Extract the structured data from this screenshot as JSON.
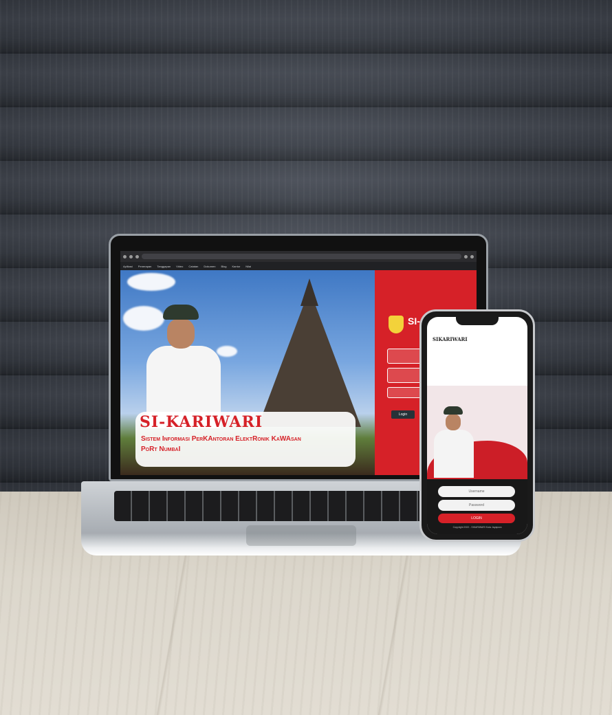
{
  "browser": {
    "bookmarks": [
      "Aplikasi",
      "Penerapan",
      "Tanggapan",
      "Video",
      "Catatan",
      "Dokumen",
      "Blog",
      "Kantor",
      "Nilai"
    ]
  },
  "laptop_site": {
    "app_title": "SI-KARIWARI",
    "subtitle_line1": "Sistem Informasi PerKAntoran ElektRonik KaWAsan",
    "subtitle_line2": "PoRt NumbaI",
    "panel_title": "SI-",
    "login_label": "Login"
  },
  "phone_site": {
    "app_name": "SIKARIWARI",
    "username_placeholder": "Username",
    "password_placeholder": "Password",
    "login_label": "LOGIN",
    "copyright": "Copyright 2022 - SIKARIWARI Kota Jayapura"
  },
  "colors": {
    "brand_red": "#d62128",
    "panel_dark": "#263238",
    "badge_yellow": "#f3d23a"
  }
}
